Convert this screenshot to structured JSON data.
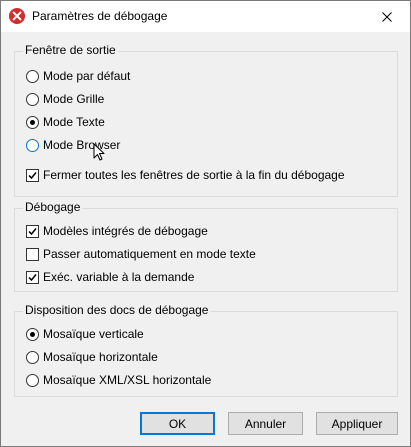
{
  "window": {
    "title": "Paramètres de débogage"
  },
  "groups": {
    "output": {
      "title": "Fenêtre de sortie",
      "options": [
        {
          "label": "Mode par défaut",
          "checked": false
        },
        {
          "label": "Mode Grille",
          "checked": false
        },
        {
          "label": "Mode Texte",
          "checked": true
        },
        {
          "label": "Mode Browser",
          "checked": false
        }
      ],
      "close_all_label": "Fermer toutes les fenêtres de sortie à la fin du débogage",
      "close_all_checked": true
    },
    "debug": {
      "title": "Débogage",
      "options": [
        {
          "label": "Modèles intégrés de débogage",
          "checked": true
        },
        {
          "label": "Passer automatiquement en mode texte",
          "checked": false
        },
        {
          "label": "Exéc. variable à la demande",
          "checked": true
        }
      ]
    },
    "layout": {
      "title": "Disposition des docs de débogage",
      "options": [
        {
          "label": "Mosaïque verticale",
          "checked": true
        },
        {
          "label": "Mosaïque horizontale",
          "checked": false
        },
        {
          "label": "Mosaïque XML/XSL horizontale",
          "checked": false
        }
      ]
    }
  },
  "buttons": {
    "ok": "OK",
    "cancel": "Annuler",
    "apply": "Appliquer"
  }
}
